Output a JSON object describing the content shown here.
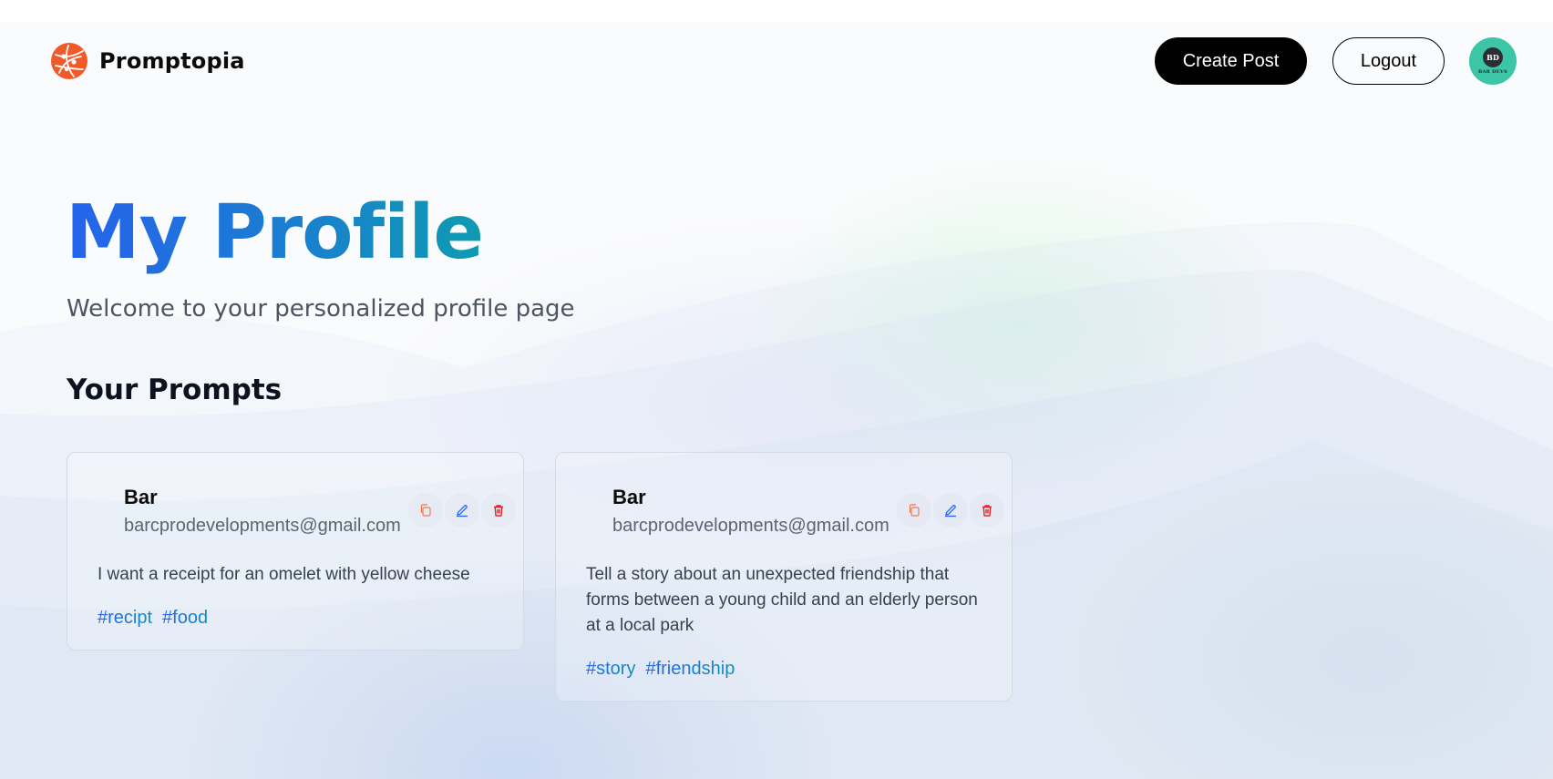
{
  "nav": {
    "brand_name": "Promptopia",
    "create_post_label": "Create Post",
    "logout_label": "Logout",
    "avatar_initials": "BD",
    "avatar_caption": "BAR DEVS"
  },
  "hero": {
    "title": "My Profile",
    "subtitle": "Welcome to your personalized profile page"
  },
  "section_title": "Your Prompts",
  "cards": [
    {
      "author_name": "Bar",
      "author_email": "barcprodevelopments@gmail.com",
      "prompt": "I want a receipt for an omelet with yellow cheese",
      "tags": [
        "#recipt",
        "#food"
      ]
    },
    {
      "author_name": "Bar",
      "author_email": "barcprodevelopments@gmail.com",
      "prompt": "Tell a story about an unexpected friendship that forms between a young child and an elderly person at a local park",
      "tags": [
        "#story",
        "#friendship"
      ]
    }
  ],
  "icons": {
    "copy": "copy-icon",
    "edit": "pencil-icon",
    "delete": "trash-icon"
  },
  "colors": {
    "brand_orange": "#f05a28",
    "title_gradient_start": "#2563eb",
    "title_gradient_end": "#0e9bb0",
    "avatar_bg": "#3cc5a6",
    "delete_red": "#dc2626",
    "edit_blue": "#2563eb",
    "copy_orange": "#f07a50"
  }
}
